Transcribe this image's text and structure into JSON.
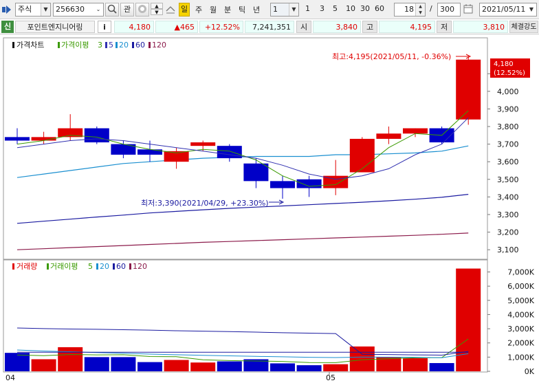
{
  "toolbar": {
    "market_type": "주식",
    "stock_code": "256630",
    "watch_label": "관",
    "periods": [
      "일",
      "주",
      "월",
      "분",
      "틱",
      "년"
    ],
    "active_period": "일",
    "interval_value": "1",
    "quick_ranges": [
      "1",
      "3",
      "5",
      "10",
      "30",
      "60"
    ],
    "range_value": "18",
    "range_separator": "/",
    "range_total": "300",
    "date": "2021/05/11"
  },
  "info": {
    "credit_badge": "신",
    "stock_name": "포인트엔지니어링",
    "info_button": "i",
    "price": "4,180",
    "change": "▲465",
    "change_pct": "+12.52%",
    "volume": "7,241,351",
    "open_label": "시",
    "open": "3,840",
    "high_label": "고",
    "high": "4,195",
    "low_label": "저",
    "low": "3,810",
    "strength_label": "체결강도"
  },
  "price_panel": {
    "legend_title": "가격차트",
    "legend_ma_title": "가격이평",
    "legend_ma": [
      "3",
      "5",
      "20",
      "60",
      "120"
    ],
    "max_note": "최고:4,195(2021/05/11, -0.36%)",
    "min_note": "최저:3,390(2021/04/29, +23.30%)",
    "current_price_tag": "4,180",
    "current_pct_tag": "(12.52%)",
    "y_ticks": [
      "4,180",
      "4,100",
      "4,000",
      "3,900",
      "3,800",
      "3,700",
      "3,600",
      "3,500",
      "3,400",
      "3,300",
      "3,200",
      "3,100"
    ]
  },
  "volume_panel": {
    "legend_title": "거래량",
    "legend_ma_title": "거래이평",
    "legend_ma": [
      "5",
      "20",
      "60",
      "120"
    ],
    "y_ticks": [
      "7,000K",
      "6,000K",
      "5,000K",
      "4,000K",
      "3,000K",
      "2,000K",
      "1,000K",
      "0K"
    ]
  },
  "x_labels": [
    "04",
    "05"
  ],
  "colors": {
    "up": "#e00000",
    "down": "#0000c8",
    "ma3": "#3a9a00",
    "ma5": "#3030b0",
    "ma20": "#1a8fd0",
    "ma60": "#1a1aa0",
    "ma120": "#8b1a4a"
  },
  "chart_data": {
    "type": "candlestick",
    "x_labels": [
      "04",
      "05"
    ],
    "candles": [
      {
        "open": 3740,
        "high": 3790,
        "low": 3700,
        "close": 3720
      },
      {
        "open": 3720,
        "high": 3770,
        "low": 3700,
        "close": 3740
      },
      {
        "open": 3740,
        "high": 3870,
        "low": 3720,
        "close": 3790
      },
      {
        "open": 3790,
        "high": 3800,
        "low": 3700,
        "close": 3710
      },
      {
        "open": 3700,
        "high": 3720,
        "low": 3620,
        "close": 3640
      },
      {
        "open": 3670,
        "high": 3720,
        "low": 3600,
        "close": 3640
      },
      {
        "open": 3600,
        "high": 3680,
        "low": 3560,
        "close": 3660
      },
      {
        "open": 3690,
        "high": 3720,
        "low": 3660,
        "close": 3710
      },
      {
        "open": 3690,
        "high": 3700,
        "low": 3600,
        "close": 3620
      },
      {
        "open": 3590,
        "high": 3620,
        "low": 3450,
        "close": 3490
      },
      {
        "open": 3490,
        "high": 3520,
        "low": 3390,
        "close": 3450
      },
      {
        "open": 3500,
        "high": 3520,
        "low": 3400,
        "close": 3450
      },
      {
        "open": 3450,
        "high": 3610,
        "low": 3410,
        "close": 3520
      },
      {
        "open": 3540,
        "high": 3740,
        "low": 3540,
        "close": 3730
      },
      {
        "open": 3730,
        "high": 3800,
        "low": 3700,
        "close": 3760
      },
      {
        "open": 3760,
        "high": 3790,
        "low": 3740,
        "close": 3790
      },
      {
        "open": 3790,
        "high": 3800,
        "low": 3700,
        "close": 3710
      },
      {
        "open": 3840,
        "high": 4195,
        "low": 3810,
        "close": 4180
      }
    ],
    "ma_series": [
      {
        "name": "3",
        "values": [
          3700,
          3720,
          3750,
          3740,
          3700,
          3670,
          3650,
          3670,
          3660,
          3610,
          3520,
          3460,
          3470,
          3560,
          3680,
          3760,
          3750,
          3890
        ]
      },
      {
        "name": "5",
        "values": [
          3680,
          3700,
          3720,
          3730,
          3720,
          3700,
          3680,
          3660,
          3640,
          3620,
          3580,
          3530,
          3500,
          3520,
          3560,
          3640,
          3700,
          3850
        ]
      },
      {
        "name": "20",
        "values": [
          3510,
          3530,
          3550,
          3570,
          3590,
          3600,
          3610,
          3620,
          3625,
          3630,
          3630,
          3630,
          3640,
          3640,
          3645,
          3650,
          3660,
          3690
        ]
      },
      {
        "name": "60",
        "values": [
          3250,
          3262,
          3274,
          3286,
          3297,
          3309,
          3318,
          3327,
          3335,
          3342,
          3349,
          3356,
          3363,
          3370,
          3378,
          3387,
          3398,
          3415
        ]
      },
      {
        "name": "120",
        "values": [
          3100,
          3106,
          3112,
          3118,
          3124,
          3130,
          3136,
          3142,
          3147,
          3152,
          3157,
          3162,
          3167,
          3172,
          3177,
          3182,
          3188,
          3195
        ]
      }
    ],
    "volume": [
      1300,
      850,
      1700,
      1000,
      1000,
      650,
      800,
      620,
      700,
      850,
      560,
      430,
      500,
      1750,
      1000,
      920,
      580,
      7240
    ],
    "volume_up": [
      false,
      true,
      true,
      false,
      false,
      false,
      true,
      true,
      false,
      false,
      false,
      false,
      true,
      true,
      true,
      true,
      false,
      true
    ],
    "volume_ma": [
      {
        "name": "5",
        "values": [
          1150,
          1100,
          1180,
          1160,
          1170,
          1040,
          1030,
          815,
          755,
          725,
          700,
          620,
          610,
          810,
          890,
          950,
          970,
          2280
        ]
      },
      {
        "name": "20",
        "values": [
          1500,
          1430,
          1380,
          1320,
          1270,
          1210,
          1170,
          1130,
          1090,
          1050,
          1020,
          990,
          970,
          1010,
          1000,
          990,
          960,
          1240
        ]
      },
      {
        "name": "60",
        "values": [
          3050,
          3010,
          2980,
          2960,
          2930,
          2900,
          2860,
          2830,
          2800,
          2760,
          2720,
          2690,
          2660,
          1200,
          1180,
          1160,
          1140,
          1400
        ]
      },
      {
        "name": "120",
        "values": [
          1340,
          1340,
          1340,
          1340,
          1340,
          1340,
          1340,
          1340,
          1340,
          1340,
          1340,
          1340,
          1340,
          1340,
          1340,
          1340,
          1340,
          1340
        ]
      }
    ],
    "price_range": [
      3050,
      4300
    ],
    "volume_range": [
      0,
      7800
    ]
  }
}
